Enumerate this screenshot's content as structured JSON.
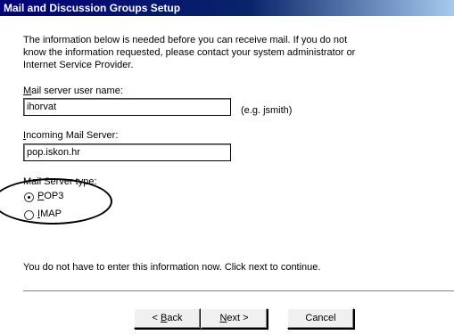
{
  "window": {
    "title": "Mail and Discussion Groups Setup"
  },
  "intro": {
    "line1": "The information below is needed before you can receive mail.  If you do not",
    "line2": "know the information requested, please contact your system administrator or",
    "line3": "Internet Service Provider."
  },
  "username": {
    "label_first": "M",
    "label_rest": "ail server user name:",
    "value": "ihorvat",
    "hint": "(e.g. jsmith)"
  },
  "incoming": {
    "label_first": "I",
    "label_rest": "ncoming Mail Server:",
    "value": "pop.iskon.hr"
  },
  "server_type": {
    "label": "Mail Server type:",
    "options": [
      {
        "label_first": "P",
        "label_rest": "OP3",
        "selected": true
      },
      {
        "label_first": "I",
        "label_rest": "MAP",
        "selected": false
      }
    ]
  },
  "footer_text": "You do not have to enter this information now. Click next to continue.",
  "buttons": {
    "back_prefix": "< ",
    "back_first": "B",
    "back_rest": "ack",
    "next_first": "N",
    "next_rest": "ext >",
    "cancel": "Cancel"
  }
}
